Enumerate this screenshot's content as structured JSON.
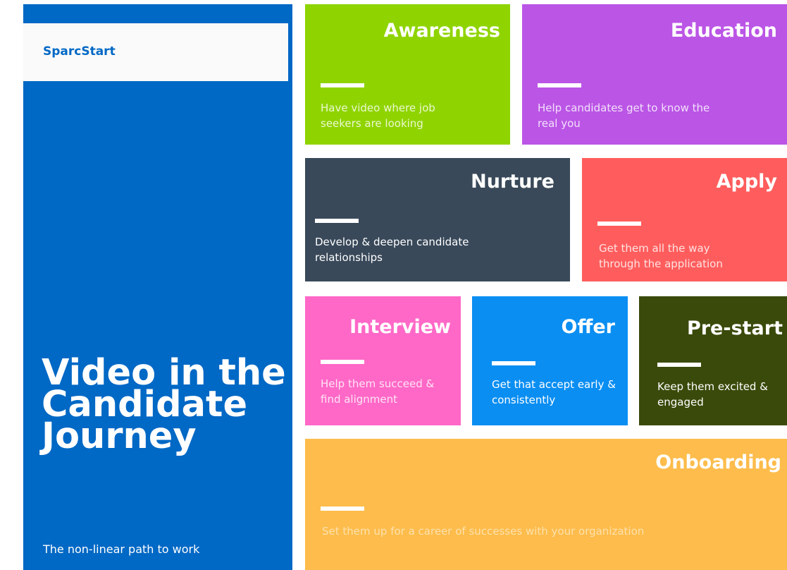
{
  "brand": {
    "name": "SparcStart"
  },
  "hero": {
    "title": "Video in the Candidate Journey",
    "subtitle": "The non-linear path to work"
  },
  "stages": {
    "awareness": {
      "title": "Awareness",
      "desc": "Have video where job seekers are looking",
      "color": "#8fd400"
    },
    "education": {
      "title": "Education",
      "desc": "Help candidates get to know the real you",
      "color": "#bb55e6"
    },
    "nurture": {
      "title": "Nurture",
      "desc": "Develop & deepen candidate relationships",
      "color": "#39495a"
    },
    "apply": {
      "title": "Apply",
      "desc": "Get them all the way through the application",
      "color": "#ff5d5d"
    },
    "interview": {
      "title": "Interview",
      "desc": "Help them succeed & find alignment",
      "color": "#ff68c7"
    },
    "offer": {
      "title": "Offer",
      "desc": "Get that accept early & consistently",
      "color": "#0a8ef2"
    },
    "prestart": {
      "title": "Pre-start",
      "desc": "Keep them excited & engaged",
      "color": "#3a4a0a"
    },
    "onboarding": {
      "title": "Onboarding",
      "desc": "Set them up for a career of successes with your organization",
      "color": "#fdbc4b"
    }
  },
  "colors": {
    "left_panel": "#0068c5",
    "brand_box": "#fafafa"
  }
}
